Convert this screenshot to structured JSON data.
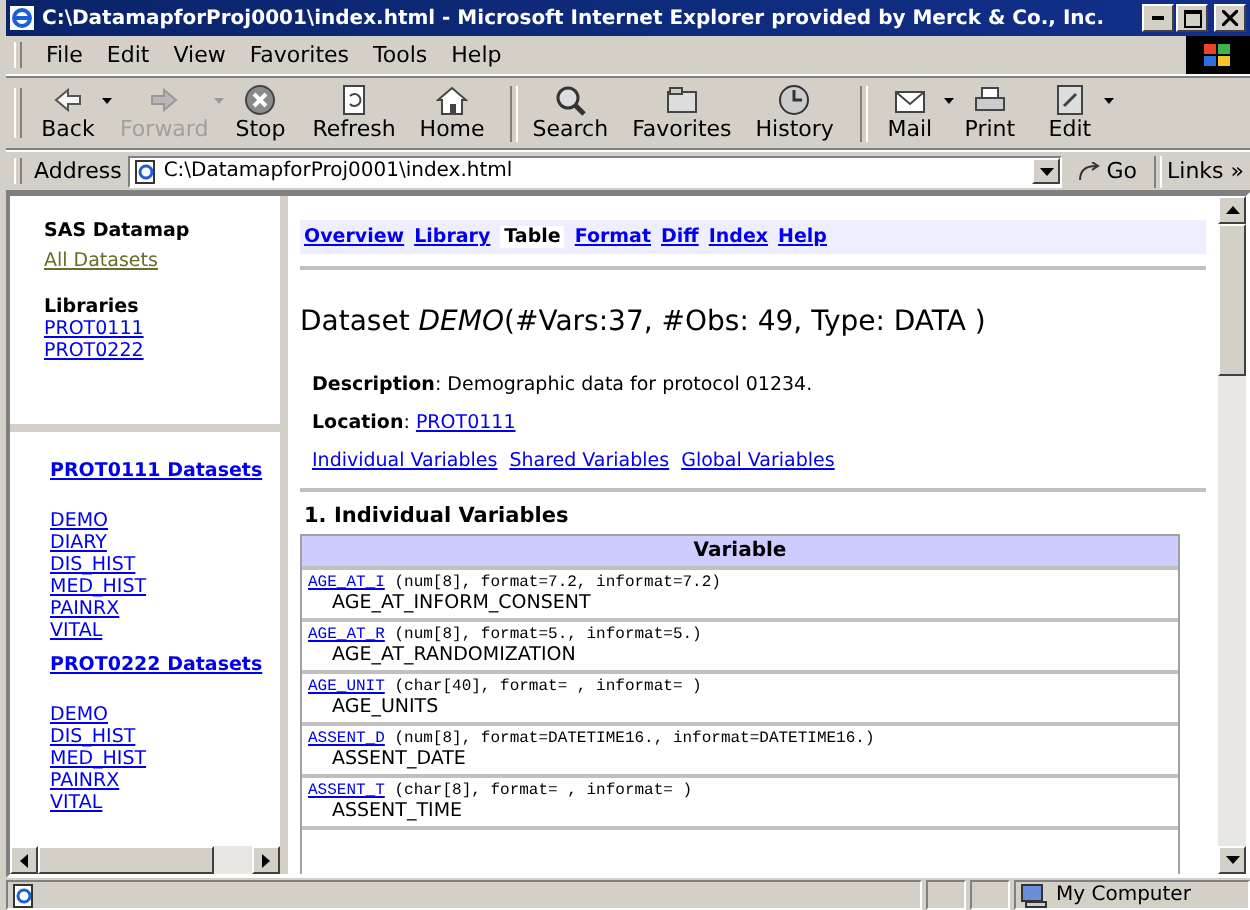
{
  "window": {
    "title": "C:\\DatamapforProj0001\\index.html - Microsoft Internet Explorer provided by Merck & Co., Inc."
  },
  "menu": [
    "File",
    "Edit",
    "View",
    "Favorites",
    "Tools",
    "Help"
  ],
  "toolbar": [
    {
      "kind": "back",
      "label": "Back",
      "disabled": false,
      "dropdown": true
    },
    {
      "kind": "forward",
      "label": "Forward",
      "disabled": true,
      "dropdown": true
    },
    {
      "kind": "stop",
      "label": "Stop",
      "disabled": false,
      "dropdown": false
    },
    {
      "kind": "refresh",
      "label": "Refresh",
      "disabled": false,
      "dropdown": false
    },
    {
      "kind": "home",
      "label": "Home",
      "disabled": false,
      "dropdown": false
    },
    {
      "kind": "search",
      "label": "Search",
      "disabled": false,
      "dropdown": false
    },
    {
      "kind": "favorites",
      "label": "Favorites",
      "disabled": false,
      "dropdown": false
    },
    {
      "kind": "history",
      "label": "History",
      "disabled": false,
      "dropdown": false
    },
    {
      "kind": "mail",
      "label": "Mail",
      "disabled": false,
      "dropdown": true
    },
    {
      "kind": "print",
      "label": "Print",
      "disabled": false,
      "dropdown": false
    },
    {
      "kind": "edit",
      "label": "Edit",
      "disabled": false,
      "dropdown": true
    }
  ],
  "address": {
    "label": "Address",
    "value": "C:\\DatamapforProj0001\\index.html",
    "go": "Go",
    "links": "Links",
    "links_chevron": "»"
  },
  "sidebar": {
    "title": "SAS Datamap",
    "all_link": "All Datasets",
    "libraries_heading": "Libraries",
    "libraries": [
      "PROT0111",
      "PROT0222"
    ],
    "groups": [
      {
        "heading": "PROT0111 Datasets",
        "items": [
          "DEMO",
          "DIARY",
          "DIS_HIST",
          "MED_HIST",
          "PAINRX",
          "VITAL"
        ]
      },
      {
        "heading": "PROT0222 Datasets",
        "items": [
          "DEMO",
          "DIS_HIST",
          "MED_HIST",
          "PAINRX",
          "VITAL"
        ]
      }
    ]
  },
  "tabs": [
    {
      "label": "Overview",
      "selected": false
    },
    {
      "label": "Library",
      "selected": false
    },
    {
      "label": "Table",
      "selected": true
    },
    {
      "label": "Format",
      "selected": false
    },
    {
      "label": "Diff",
      "selected": false
    },
    {
      "label": "Index",
      "selected": false
    },
    {
      "label": "Help",
      "selected": false
    }
  ],
  "dataset": {
    "prefix": "Dataset",
    "name": "DEMO",
    "detail": "(#Vars:37, #Obs: 49, Type: DATA )",
    "description_label": "Description",
    "description": ": Demographic data for protocol 01234.",
    "location_label": "Location",
    "location_sep": ":",
    "location": "PROT0111",
    "links": [
      "Individual Variables",
      "Shared Variables",
      "Global Variables"
    ]
  },
  "section": {
    "title": "1. Individual Variables",
    "header": "Variable",
    "rows": [
      {
        "link": "AGE_AT_I",
        "spec": "(num[8],  format=7.2,  informat=7.2)",
        "label": "AGE_AT_INFORM_CONSENT"
      },
      {
        "link": "AGE_AT_R",
        "spec": "(num[8],  format=5.,  informat=5.)",
        "label": "AGE_AT_RANDOMIZATION"
      },
      {
        "link": "AGE_UNIT",
        "spec": "(char[40],  format= ,  informat= )",
        "label": "AGE_UNITS"
      },
      {
        "link": "ASSENT_D",
        "spec": "(num[8],  format=DATETIME16.,  informat=DATETIME16.)",
        "label": "ASSENT_DATE"
      },
      {
        "link": "ASSENT_T",
        "spec": "(char[8],  format= ,  informat= )",
        "label": "ASSENT_TIME"
      }
    ]
  },
  "status": {
    "zone": "My Computer"
  }
}
